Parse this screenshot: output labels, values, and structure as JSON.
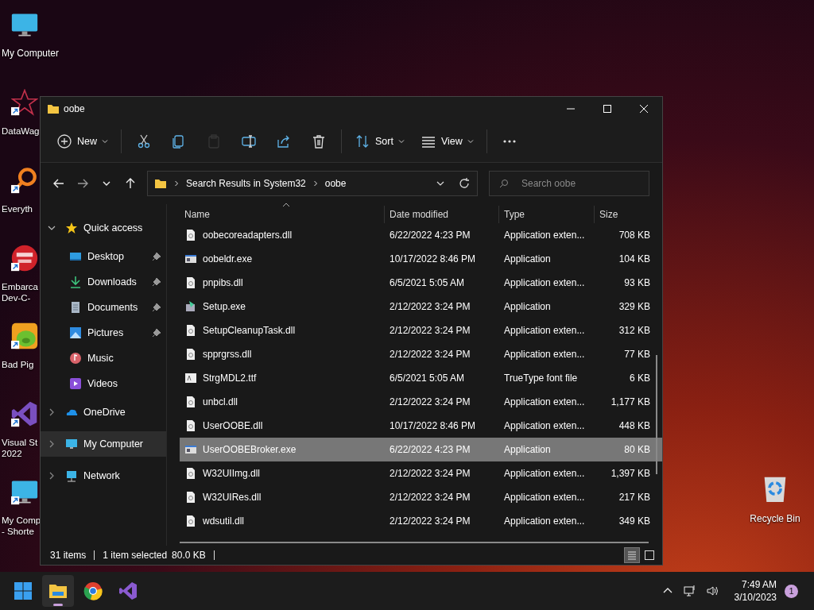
{
  "desktop_icons": [
    {
      "kind": "monitor",
      "lines": [
        "My Computer"
      ],
      "shortcut": false
    },
    {
      "kind": "star",
      "lines": [
        "DataWag"
      ],
      "shortcut": true
    },
    {
      "kind": "magnifier",
      "lines": [
        "Everyth"
      ],
      "shortcut": true
    },
    {
      "kind": "dev",
      "lines": [
        "Embarca",
        "Dev-C-"
      ],
      "shortcut": true
    },
    {
      "kind": "game",
      "lines": [
        "Bad Pig"
      ],
      "shortcut": true
    },
    {
      "kind": "vs",
      "lines": [
        "Visual St",
        "2022"
      ],
      "shortcut": true
    },
    {
      "kind": "monitor",
      "lines": [
        "My Comp",
        "- Shorte"
      ],
      "shortcut": true
    }
  ],
  "recycle_bin": {
    "label": "Recycle Bin"
  },
  "window": {
    "title": "oobe",
    "toolbar": [
      [
        {
          "kind": "new",
          "label": "New",
          "dropdown": true,
          "disabled": false
        }
      ],
      [
        {
          "kind": "cut",
          "disabled": false
        },
        {
          "kind": "copy",
          "disabled": false
        },
        {
          "kind": "paste",
          "disabled": true
        },
        {
          "kind": "rename",
          "disabled": false
        },
        {
          "kind": "share",
          "disabled": false
        },
        {
          "kind": "delete",
          "disabled": false
        }
      ],
      [
        {
          "kind": "sort",
          "label": "Sort",
          "dropdown": true,
          "disabled": false
        },
        {
          "kind": "view",
          "label": "View",
          "dropdown": true,
          "disabled": false
        }
      ],
      [
        {
          "kind": "more",
          "disabled": false
        }
      ]
    ],
    "address": {
      "crumbs": [
        "Search Results in System32",
        "oobe"
      ]
    },
    "search": {
      "placeholder": "Search oobe"
    },
    "sidebar": [
      {
        "kind": "star",
        "label": "Quick access",
        "expanded": true,
        "selected": false,
        "children": [
          {
            "kind": "desktop",
            "label": "Desktop",
            "pinned": true,
            "selected": false
          },
          {
            "kind": "download",
            "label": "Downloads",
            "pinned": true,
            "selected": false
          },
          {
            "kind": "document",
            "label": "Documents",
            "pinned": true,
            "selected": false
          },
          {
            "kind": "picture",
            "label": "Pictures",
            "pinned": true,
            "selected": false
          },
          {
            "kind": "music",
            "label": "Music",
            "pinned": false,
            "selected": false
          },
          {
            "kind": "video",
            "label": "Videos",
            "pinned": false,
            "selected": false
          }
        ]
      },
      {
        "kind": "cloud",
        "label": "OneDrive",
        "expanded": false,
        "selected": false
      },
      {
        "kind": "monitor",
        "label": "My Computer",
        "expanded": false,
        "selected": true
      },
      {
        "kind": "network",
        "label": "Network",
        "expanded": false,
        "selected": false
      }
    ],
    "columns": [
      {
        "label": "Name",
        "sorted": true
      },
      {
        "label": "Date modified",
        "sorted": false
      },
      {
        "label": "Type",
        "sorted": false
      },
      {
        "label": "Size",
        "sorted": false
      }
    ],
    "rows": [
      {
        "kind": "dll",
        "name": "oobecoreadapters.dll",
        "date": "6/22/2022 4:23 PM",
        "type": "Application exten...",
        "size": "708 KB",
        "selected": false
      },
      {
        "kind": "exe",
        "name": "oobeldr.exe",
        "date": "10/17/2022 8:46 PM",
        "type": "Application",
        "size": "104 KB",
        "selected": false
      },
      {
        "kind": "dll",
        "name": "pnpibs.dll",
        "date": "6/5/2021 5:05 AM",
        "type": "Application exten...",
        "size": "93 KB",
        "selected": false
      },
      {
        "kind": "setup",
        "name": "Setup.exe",
        "date": "2/12/2022 3:24 PM",
        "type": "Application",
        "size": "329 KB",
        "selected": false
      },
      {
        "kind": "dll",
        "name": "SetupCleanupTask.dll",
        "date": "2/12/2022 3:24 PM",
        "type": "Application exten...",
        "size": "312 KB",
        "selected": false
      },
      {
        "kind": "dll",
        "name": "spprgrss.dll",
        "date": "2/12/2022 3:24 PM",
        "type": "Application exten...",
        "size": "77 KB",
        "selected": false
      },
      {
        "kind": "font",
        "name": "StrgMDL2.ttf",
        "date": "6/5/2021 5:05 AM",
        "type": "TrueType font file",
        "size": "6 KB",
        "selected": false
      },
      {
        "kind": "dll",
        "name": "unbcl.dll",
        "date": "2/12/2022 3:24 PM",
        "type": "Application exten...",
        "size": "1,177 KB",
        "selected": false
      },
      {
        "kind": "dll",
        "name": "UserOOBE.dll",
        "date": "10/17/2022 8:46 PM",
        "type": "Application exten...",
        "size": "448 KB",
        "selected": false
      },
      {
        "kind": "exe",
        "name": "UserOOBEBroker.exe",
        "date": "6/22/2022 4:23 PM",
        "type": "Application",
        "size": "80 KB",
        "selected": true
      },
      {
        "kind": "dll",
        "name": "W32UIImg.dll",
        "date": "2/12/2022 3:24 PM",
        "type": "Application exten...",
        "size": "1,397 KB",
        "selected": false
      },
      {
        "kind": "dll",
        "name": "W32UIRes.dll",
        "date": "2/12/2022 3:24 PM",
        "type": "Application exten...",
        "size": "217 KB",
        "selected": false
      },
      {
        "kind": "dll",
        "name": "wdsutil.dll",
        "date": "2/12/2022 3:24 PM",
        "type": "Application exten...",
        "size": "349 KB",
        "selected": false
      }
    ],
    "status": {
      "count": "31 items",
      "selection": "1 item selected",
      "size": "80.0 KB"
    },
    "view_buttons": [
      {
        "kind": "details",
        "selected": true
      },
      {
        "kind": "tiles",
        "selected": false
      }
    ]
  },
  "taskbar": {
    "apps": [
      {
        "kind": "start",
        "active": false
      },
      {
        "kind": "explorer",
        "active": true
      },
      {
        "kind": "chrome",
        "active": false
      },
      {
        "kind": "vs",
        "active": false
      }
    ],
    "time": "7:49 AM",
    "date": "3/10/2023",
    "notifications": "1"
  }
}
